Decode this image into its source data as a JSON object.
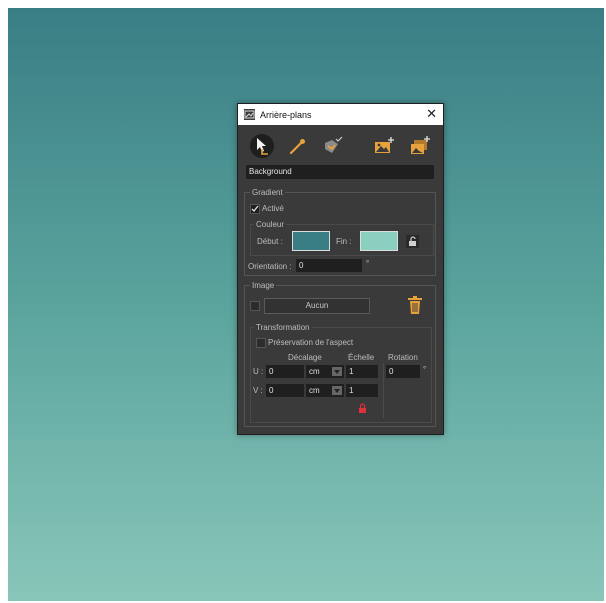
{
  "window": {
    "title": "Arrière-plans",
    "close_label": "✕"
  },
  "toolbar": {
    "tools": [
      {
        "name": "select-tool-icon"
      },
      {
        "name": "eyedropper-tool-icon"
      },
      {
        "name": "apply-tool-icon"
      },
      {
        "name": "add-image-icon"
      },
      {
        "name": "add-images-icon"
      }
    ],
    "accent_color": "#e8a23c"
  },
  "background_name": "Background",
  "gradient": {
    "label": "Gradient",
    "active_label": "Activé",
    "active_checked": true,
    "color_group_label": "Couleur",
    "start_label": "Début :",
    "start_color": "#3a7e85",
    "end_label": "Fin :",
    "end_color": "#8bcfc0",
    "orientation_label": "Orientation :",
    "orientation_value": "0",
    "orientation_unit": "°"
  },
  "image": {
    "label": "Image",
    "button_label": "Aucun",
    "transformation": {
      "label": "Transformation",
      "preserve_aspect_label": "Préservation de l'aspect",
      "offset_header": "Décalage",
      "scale_header": "Échelle",
      "rotation_header": "Rotation",
      "u_label": "U :",
      "v_label": "V :",
      "u_offset": "0",
      "v_offset": "0",
      "u_unit": "cm",
      "v_unit": "cm",
      "u_scale": "1",
      "v_scale": "1",
      "rotation_value": "0",
      "rotation_unit": "°"
    }
  }
}
